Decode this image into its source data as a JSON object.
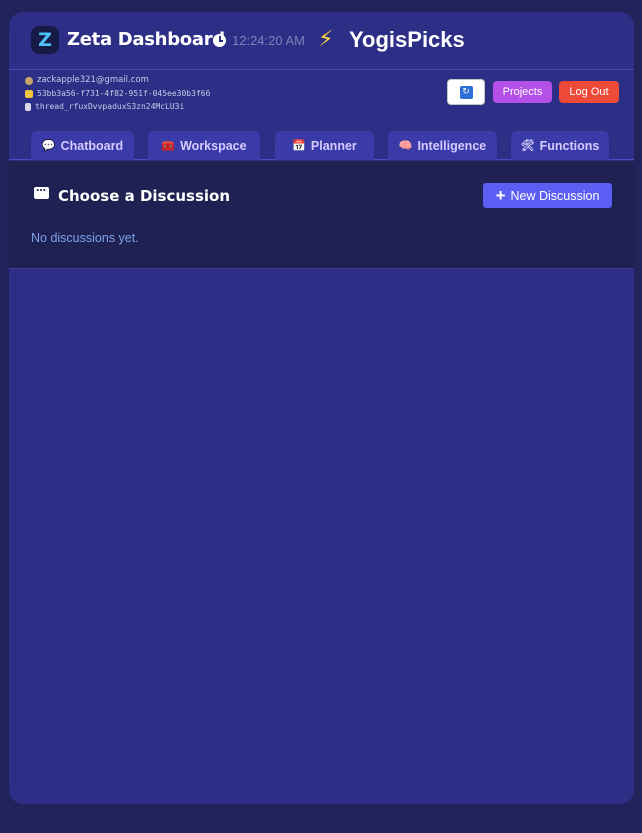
{
  "header": {
    "logo_letter": "Z",
    "title": "Zeta Dashboard",
    "time": "12:24:20 AM",
    "brand": "YogisPicks"
  },
  "meta": {
    "email": "zackapple321@gmail.com",
    "project_id": "53bb3a56-f731-4f82-951f-045ee30b3f66",
    "thread_id": "thread_rfuxDvvpaduxS3zn24McLU3i"
  },
  "toolbar": {
    "projects_label": "Projects",
    "logout_label": "Log Out"
  },
  "tabs": [
    {
      "label": "Chatboard",
      "icon": "speech-bubble-icon"
    },
    {
      "label": "Workspace",
      "icon": "toolbox-icon"
    },
    {
      "label": "Planner",
      "icon": "calendar-icon"
    },
    {
      "label": "Intelligence",
      "icon": "brain-icon"
    },
    {
      "label": "Functions",
      "icon": "tools-icon"
    }
  ],
  "discussions": {
    "title": "Choose a Discussion",
    "new_button_label": "New Discussion",
    "empty_text": "No discussions yet."
  },
  "colors": {
    "background": "#22235a",
    "card": "#2c2f85",
    "panel": "#1e2152",
    "projects": "#b44fe8",
    "logout": "#ee4a3a",
    "new_discussion": "#5b5ef2"
  }
}
